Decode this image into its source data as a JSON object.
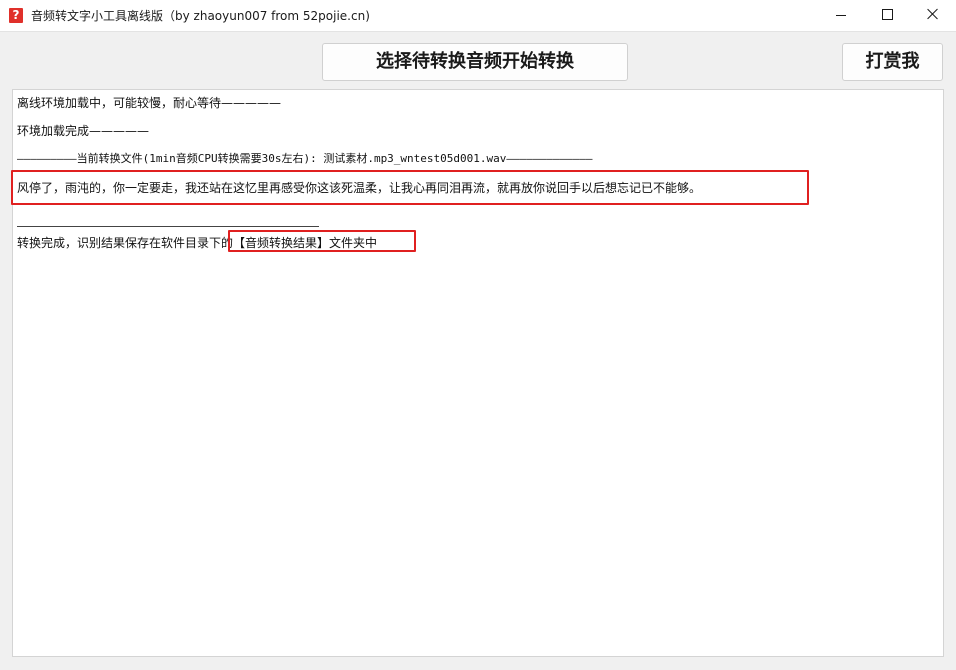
{
  "window": {
    "title": "音频转文字小工具离线版（by zhaoyun007 from 52pojie.cn)",
    "icon": "question-icon"
  },
  "toolbar": {
    "convert_label": "选择待转换音频开始转换",
    "donate_label": "打赏我"
  },
  "log": {
    "line1": "离线环境加载中，可能较慢，耐心等待—————",
    "line2": "环境加载完成—————",
    "line3": "—————————当前转换文件(1min音频CPU转换需要30s左右): 测试素材.mp3_wntest05d001.wav—————————————",
    "line4": "风停了，雨沌的，你一定要走，我还站在这忆里再感受你这该死温柔，让我心再同泪再流，就再放你说回手以后想忘记已不能够。",
    "line5": "转换完成，识别结果保存在软件目录下的【音频转换结果】文件夹中"
  },
  "colors": {
    "highlight": "#e02020",
    "app_icon": "#e0302a"
  }
}
